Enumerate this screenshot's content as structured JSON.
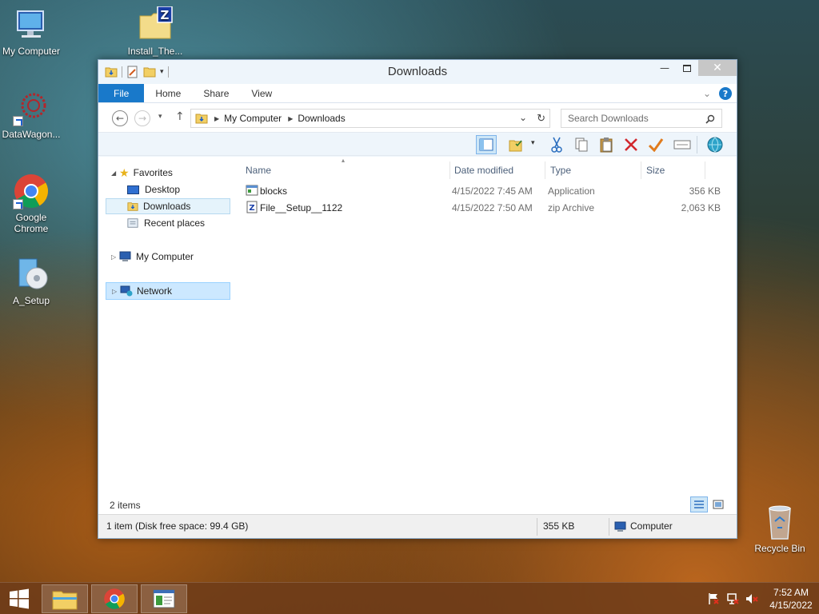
{
  "desktop": {
    "icons": [
      {
        "label": "My Computer",
        "icon": "computer-icon"
      },
      {
        "label": "Install_The...",
        "icon": "zip-archive-icon"
      },
      {
        "label": "DataWagon...",
        "icon": "datawagon-icon"
      },
      {
        "label": "Google Chrome",
        "icon": "chrome-icon"
      },
      {
        "label": "A_Setup",
        "icon": "setup-icon"
      },
      {
        "label": "Recycle Bin",
        "icon": "recycle-bin-icon"
      }
    ]
  },
  "window": {
    "title": "Downloads",
    "tabs": [
      {
        "label": "File",
        "active": true
      },
      {
        "label": "Home"
      },
      {
        "label": "Share"
      },
      {
        "label": "View"
      }
    ],
    "address": {
      "segments": [
        "My Computer",
        "Downloads"
      ]
    },
    "search": {
      "placeholder": "Search Downloads"
    },
    "nav": {
      "favorites": "Favorites",
      "desktop": "Desktop",
      "downloads": "Downloads",
      "recent": "Recent places",
      "my_computer": "My Computer",
      "network": "Network"
    },
    "columns": {
      "name": "Name",
      "date": "Date modified",
      "type": "Type",
      "size": "Size"
    },
    "files": [
      {
        "name": "blocks",
        "date": "4/15/2022 7:45 AM",
        "type": "Application",
        "size": "356 KB"
      },
      {
        "name": "File__Setup__1122",
        "date": "4/15/2022 7:50 AM",
        "type": "zip Archive",
        "size": "2,063 KB"
      }
    ],
    "items_count": "2 items",
    "status": {
      "selection": "1 item (Disk free space: 99.4 GB)",
      "size": "355 KB",
      "location": "Computer"
    }
  },
  "taskbar": {
    "clock_time": "7:52 AM",
    "clock_date": "4/15/2022"
  },
  "colors": {
    "accent": "#1979ca",
    "selection": "#cce8ff"
  }
}
